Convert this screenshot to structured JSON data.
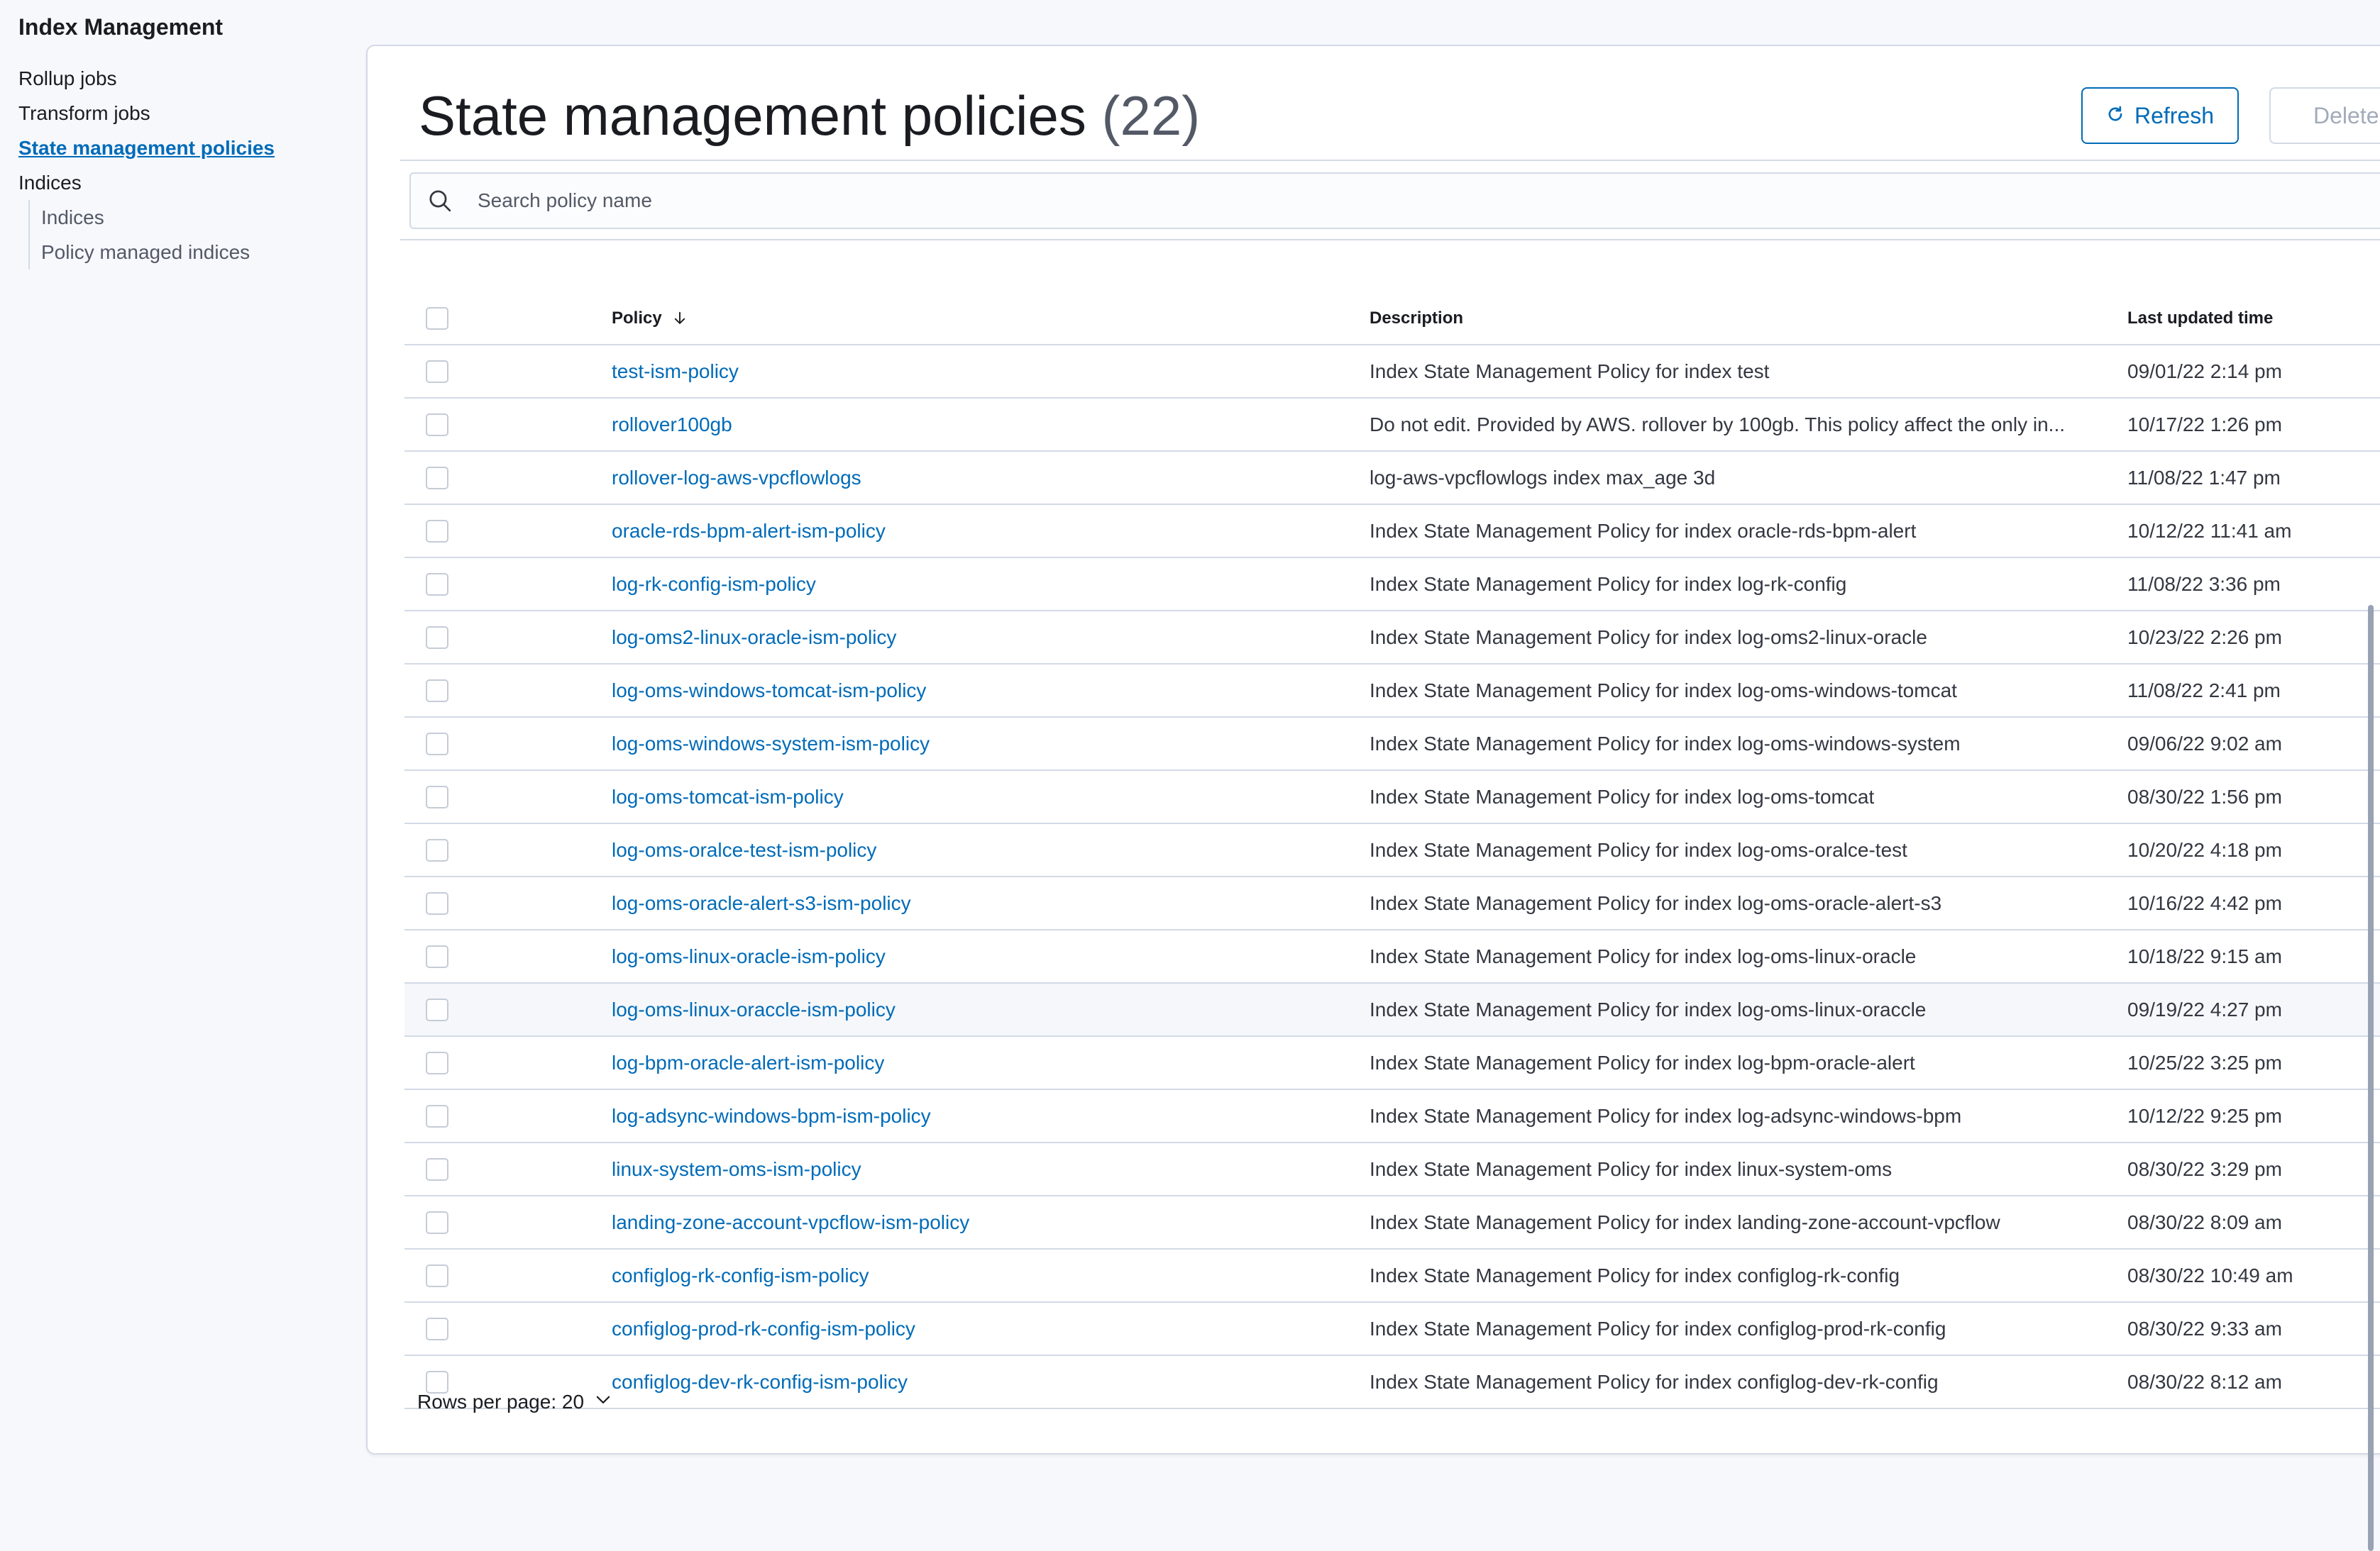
{
  "sidebar": {
    "title": "Index Management",
    "items": [
      {
        "label": "Rollup jobs"
      },
      {
        "label": "Transform jobs"
      },
      {
        "label": "State management policies"
      },
      {
        "label": "Indices"
      }
    ],
    "subitems": [
      {
        "label": "Indices"
      },
      {
        "label": "Policy managed indices"
      }
    ]
  },
  "header": {
    "title": "State management policies",
    "count": "(22)",
    "refresh_label": "Refresh",
    "delete_label": "Delete"
  },
  "search": {
    "placeholder": "Search policy name"
  },
  "table": {
    "columns": {
      "policy": "Policy",
      "description": "Description",
      "updated": "Last updated time"
    },
    "rows": [
      {
        "policy": "test-ism-policy",
        "description": "Index State Management Policy for index test",
        "updated": "09/01/22 2:14 pm"
      },
      {
        "policy": "rollover100gb",
        "description": "Do not edit. Provided by AWS. rollover by 100gb. This policy affect the only in...",
        "updated": "10/17/22 1:26 pm"
      },
      {
        "policy": "rollover-log-aws-vpcflowlogs",
        "description": "log-aws-vpcflowlogs index max_age 3d",
        "updated": "11/08/22 1:47 pm"
      },
      {
        "policy": "oracle-rds-bpm-alert-ism-policy",
        "description": "Index State Management Policy for index oracle-rds-bpm-alert",
        "updated": "10/12/22 11:41 am"
      },
      {
        "policy": "log-rk-config-ism-policy",
        "description": "Index State Management Policy for index log-rk-config",
        "updated": "11/08/22 3:36 pm"
      },
      {
        "policy": "log-oms2-linux-oracle-ism-policy",
        "description": "Index State Management Policy for index log-oms2-linux-oracle",
        "updated": "10/23/22 2:26 pm"
      },
      {
        "policy": "log-oms-windows-tomcat-ism-policy",
        "description": "Index State Management Policy for index log-oms-windows-tomcat",
        "updated": "11/08/22 2:41 pm"
      },
      {
        "policy": "log-oms-windows-system-ism-policy",
        "description": "Index State Management Policy for index log-oms-windows-system",
        "updated": "09/06/22 9:02 am"
      },
      {
        "policy": "log-oms-tomcat-ism-policy",
        "description": "Index State Management Policy for index log-oms-tomcat",
        "updated": "08/30/22 1:56 pm"
      },
      {
        "policy": "log-oms-oralce-test-ism-policy",
        "description": "Index State Management Policy for index log-oms-oralce-test",
        "updated": "10/20/22 4:18 pm"
      },
      {
        "policy": "log-oms-oracle-alert-s3-ism-policy",
        "description": "Index State Management Policy for index log-oms-oracle-alert-s3",
        "updated": "10/16/22 4:42 pm"
      },
      {
        "policy": "log-oms-linux-oracle-ism-policy",
        "description": "Index State Management Policy for index log-oms-linux-oracle",
        "updated": "10/18/22 9:15 am"
      },
      {
        "policy": "log-oms-linux-oraccle-ism-policy",
        "description": "Index State Management Policy for index log-oms-linux-oraccle",
        "updated": "09/19/22 4:27 pm"
      },
      {
        "policy": "log-bpm-oracle-alert-ism-policy",
        "description": "Index State Management Policy for index log-bpm-oracle-alert",
        "updated": "10/25/22 3:25 pm"
      },
      {
        "policy": "log-adsync-windows-bpm-ism-policy",
        "description": "Index State Management Policy for index log-adsync-windows-bpm",
        "updated": "10/12/22 9:25 pm"
      },
      {
        "policy": "linux-system-oms-ism-policy",
        "description": "Index State Management Policy for index linux-system-oms",
        "updated": "08/30/22 3:29 pm"
      },
      {
        "policy": "landing-zone-account-vpcflow-ism-policy",
        "description": "Index State Management Policy for index landing-zone-account-vpcflow",
        "updated": "08/30/22 8:09 am"
      },
      {
        "policy": "configlog-rk-config-ism-policy",
        "description": "Index State Management Policy for index configlog-rk-config",
        "updated": "08/30/22 10:49 am"
      },
      {
        "policy": "configlog-prod-rk-config-ism-policy",
        "description": "Index State Management Policy for index configlog-prod-rk-config",
        "updated": "08/30/22 9:33 am"
      },
      {
        "policy": "configlog-dev-rk-config-ism-policy",
        "description": "Index State Management Policy for index configlog-dev-rk-config",
        "updated": "08/30/22 8:12 am"
      }
    ]
  },
  "pagination": {
    "rows_per_page_label": "Rows per page: 20"
  },
  "colors": {
    "accent": "#006bb8",
    "border": "#d3dae6",
    "text": "#343741"
  }
}
